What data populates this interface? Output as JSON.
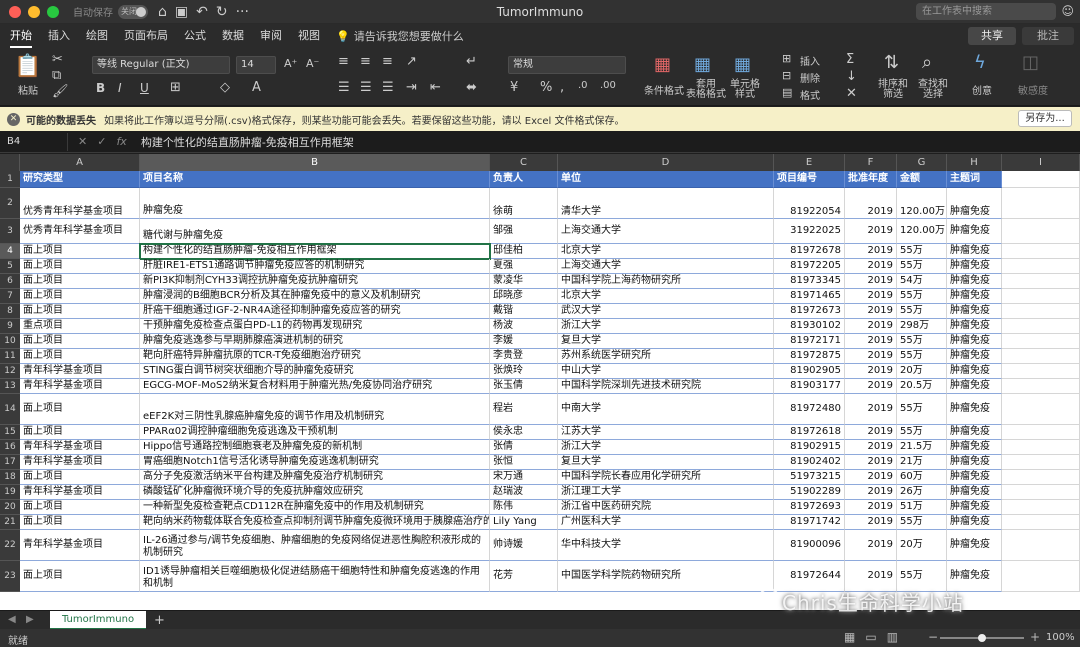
{
  "window": {
    "title": "TumorImmuno",
    "autosave_label": "自动保存",
    "autosave_state": "关闭",
    "search_placeholder": "在工作表中搜索"
  },
  "tabs": [
    "开始",
    "插入",
    "绘图",
    "页面布局",
    "公式",
    "数据",
    "审阅",
    "视图"
  ],
  "tell_me": "请告诉我您想要做什么",
  "share_label": "共享",
  "comment_label": "批注",
  "ribbon": {
    "paste": "粘贴",
    "font_name": "等线 Regular (正文)",
    "font_size": "14",
    "number_format": "常规",
    "cond_format": "条件格式",
    "table_format": "套用\n表格格式",
    "cell_style": "单元格\n样式",
    "insert": "插入",
    "delete": "删除",
    "format": "格式",
    "sort_filter": "排序和\n筛选",
    "find_select": "查找和\n选择",
    "ideas": "创意",
    "sensitivity": "敏感度"
  },
  "infobar": {
    "title": "可能的数据丢失",
    "message": "如果将此工作簿以逗号分隔(.csv)格式保存，则某些功能可能会丢失。若要保留这些功能，请以 Excel 文件格式保存。",
    "save_as": "另存为..."
  },
  "formula_bar": {
    "cell_ref": "B4",
    "content": "构建个性化的结直肠肿瘤-免疫相互作用框架"
  },
  "columns": [
    "A",
    "B",
    "C",
    "D",
    "E",
    "F",
    "G",
    "H",
    "I"
  ],
  "header_row": [
    "研究类型",
    "项目名称",
    "负责人",
    "单位",
    "项目编号",
    "批准年度",
    "金额",
    "主题词"
  ],
  "rows": [
    {
      "n": "2",
      "cells": [
        "优秀青年科学基金项目",
        "肿瘤免疫",
        "徐萌",
        "清华大学",
        "81922054",
        "2019",
        "120.00万",
        "肿瘤免疫"
      ]
    },
    {
      "n": "3",
      "cells": [
        "优秀青年科学基金项目",
        "糖代谢与肿瘤免疫",
        "邹强",
        "上海交通大学",
        "31922025",
        "2019",
        "120.00万",
        "肿瘤免疫"
      ]
    },
    {
      "n": "4",
      "cells": [
        "面上项目",
        "构建个性化的结直肠肿瘤-免疫相互作用框架",
        "邸佳柏",
        "北京大学",
        "81972678",
        "2019",
        "55万",
        "肿瘤免疫"
      ]
    },
    {
      "n": "5",
      "cells": [
        "面上项目",
        "肝脏IRE1-ETS1通路调节肿瘤免疫应答的机制研究",
        "夏强",
        "上海交通大学",
        "81972205",
        "2019",
        "55万",
        "肿瘤免疫"
      ]
    },
    {
      "n": "6",
      "cells": [
        "面上项目",
        "新PI3K抑制剂CYH33调控抗肿瘤免疫抗肿瘤研究",
        "蒙凌华",
        "中国科学院上海药物研究所",
        "81973345",
        "2019",
        "54万",
        "肿瘤免疫"
      ]
    },
    {
      "n": "7",
      "cells": [
        "面上项目",
        "肿瘤浸润的B细胞BCR分析及其在肿瘤免疫中的意义及机制研究",
        "邱晓彦",
        "北京大学",
        "81971465",
        "2019",
        "55万",
        "肿瘤免疫"
      ]
    },
    {
      "n": "8",
      "cells": [
        "面上项目",
        "肝癌干细胞通过IGF-2-NR4A途径抑制肿瘤免疫应答的研究",
        "戴锴",
        "武汉大学",
        "81972673",
        "2019",
        "55万",
        "肿瘤免疫"
      ]
    },
    {
      "n": "9",
      "cells": [
        "重点项目",
        "干预肿瘤免疫检查点蛋白PD-L1的药物再发现研究",
        "杨波",
        "浙江大学",
        "81930102",
        "2019",
        "298万",
        "肿瘤免疫"
      ]
    },
    {
      "n": "10",
      "cells": [
        "面上项目",
        "肿瘤免疫逃逸参与早期肺腺癌演进机制的研究",
        "李媛",
        "复旦大学",
        "81972171",
        "2019",
        "55万",
        "肿瘤免疫"
      ]
    },
    {
      "n": "11",
      "cells": [
        "面上项目",
        "靶向肝癌特异肿瘤抗原的TCR-T免疫细胞治疗研究",
        "李贵登",
        "苏州系统医学研究所",
        "81972875",
        "2019",
        "55万",
        "肿瘤免疫"
      ]
    },
    {
      "n": "12",
      "cells": [
        "青年科学基金项目",
        "STING蛋白调节树突状细胞介导的肿瘤免疫研究",
        "张焕玲",
        "中山大学",
        "81902905",
        "2019",
        "20万",
        "肿瘤免疫"
      ]
    },
    {
      "n": "13",
      "cells": [
        "青年科学基金项目",
        "EGCG-MOF-MoS2纳米复合材料用于肿瘤光热/免疫协同治疗研究",
        "张玉倩",
        "中国科学院深圳先进技术研究院",
        "81903177",
        "2019",
        "20.5万",
        "肿瘤免疫"
      ]
    },
    {
      "n": "14",
      "cells": [
        "面上项目",
        "eEF2K对三阴性乳腺癌肿瘤免疫的调节作用及机制研究",
        "程岩",
        "中南大学",
        "81972480",
        "2019",
        "55万",
        "肿瘤免疫"
      ]
    },
    {
      "n": "15",
      "cells": [
        "面上项目",
        "PPARα02调控肿瘤细胞免疫逃逸及干预机制",
        "侯永忠",
        "江苏大学",
        "81972618",
        "2019",
        "55万",
        "肿瘤免疫"
      ]
    },
    {
      "n": "16",
      "cells": [
        "青年科学基金项目",
        "Hippo信号通路控制细胞衰老及肿瘤免疫的新机制",
        "张倩",
        "浙江大学",
        "81902915",
        "2019",
        "21.5万",
        "肿瘤免疫"
      ]
    },
    {
      "n": "17",
      "cells": [
        "青年科学基金项目",
        "胃癌细胞Notch1信号活化诱导肿瘤免疫逃逸机制研究",
        "张恒",
        "复旦大学",
        "81902402",
        "2019",
        "21万",
        "肿瘤免疫"
      ]
    },
    {
      "n": "18",
      "cells": [
        "面上项目",
        "高分子免疫激活纳米平台构建及肿瘤免疫治疗机制研究",
        "宋万通",
        "中国科学院长春应用化学研究所",
        "51973215",
        "2019",
        "60万",
        "肿瘤免疫"
      ]
    },
    {
      "n": "19",
      "cells": [
        "青年科学基金项目",
        "磷酸锰矿化肿瘤微环境介导的免疫抗肿瘤效应研究",
        "赵瑞波",
        "浙江理工大学",
        "51902289",
        "2019",
        "26万",
        "肿瘤免疫"
      ]
    },
    {
      "n": "20",
      "cells": [
        "面上项目",
        "一种新型免疫检查靶点CD112R在肿瘤免疫中的作用及机制研究",
        "陈伟",
        "浙江省中医药研究院",
        "81972693",
        "2019",
        "51万",
        "肿瘤免疫"
      ]
    },
    {
      "n": "21",
      "cells": [
        "面上项目",
        "靶向纳米药物载体联合免疫检查点抑制剂调节肿瘤免疫微环境用于胰腺癌治疗的研究",
        "Lily Yang",
        "广州医科大学",
        "81971742",
        "2019",
        "55万",
        "肿瘤免疫"
      ]
    },
    {
      "n": "22",
      "cells": [
        "青年科学基金项目",
        "IL-26通过参与/调节免疫细胞、肿瘤细胞的免疫网络促进恶性胸腔积液形成的机制研究",
        "帅诗媛",
        "华中科技大学",
        "81900096",
        "2019",
        "20万",
        "肿瘤免疫"
      ]
    },
    {
      "n": "23",
      "cells": [
        "面上项目",
        "ID1诱导肿瘤相关巨噬细胞极化促进结肠癌干细胞特性和肿瘤免疫逃逸的作用和机制",
        "花芳",
        "中国医学科学院药物研究所",
        "81972644",
        "2019",
        "55万",
        "肿瘤免疫"
      ]
    }
  ],
  "sheet_tab": "TumorImmuno",
  "status": {
    "ready": "就绪",
    "zoom": "100%",
    "zoom_fraction": 0.5
  },
  "watermark": "Chris生命科学小站",
  "colors": {
    "header_blue": "#4472c4",
    "excel_green": "#217346"
  }
}
